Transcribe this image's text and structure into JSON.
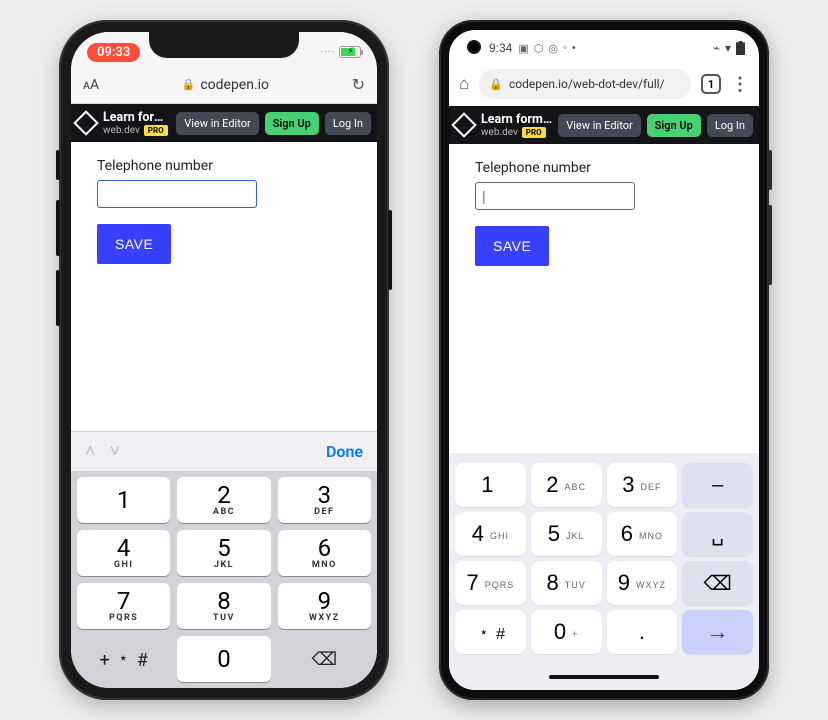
{
  "ios": {
    "status": {
      "time": "09:33"
    },
    "safari": {
      "url": "codepen.io"
    },
    "codepen": {
      "title": "Learn forms – virt…",
      "subtitle": "web.dev",
      "pro": "PRO",
      "view_btn": "View in Editor",
      "signup_btn": "Sign Up",
      "login_btn": "Log In"
    },
    "form": {
      "label": "Telephone number",
      "value": "",
      "save": "SAVE"
    },
    "accessory": {
      "done": "Done"
    },
    "keypad": {
      "symbols": "+ ﹡ #",
      "rows": [
        [
          {
            "n": "1",
            "l": ""
          },
          {
            "n": "2",
            "l": "ABC"
          },
          {
            "n": "3",
            "l": "DEF"
          }
        ],
        [
          {
            "n": "4",
            "l": "GHI"
          },
          {
            "n": "5",
            "l": "JKL"
          },
          {
            "n": "6",
            "l": "MNO"
          }
        ],
        [
          {
            "n": "7",
            "l": "PQRS"
          },
          {
            "n": "8",
            "l": "TUV"
          },
          {
            "n": "9",
            "l": "WXYZ"
          }
        ]
      ],
      "zero": "0"
    }
  },
  "android": {
    "status": {
      "time": "9:34"
    },
    "chrome": {
      "url": "codepen.io/web-dot-dev/full/",
      "tabs": "1"
    },
    "codepen": {
      "title": "Learn forms – virt…",
      "subtitle": "web.dev",
      "pro": "PRO",
      "view_btn": "View in Editor",
      "signup_btn": "Sign Up",
      "login_btn": "Log In"
    },
    "form": {
      "label": "Telephone number",
      "value": "",
      "save": "SAVE"
    },
    "keypad": {
      "rows": [
        [
          {
            "n": "1",
            "l": ""
          },
          {
            "n": "2",
            "l": "ABC"
          },
          {
            "n": "3",
            "l": "DEF"
          },
          {
            "func": "dash",
            "g": "–"
          }
        ],
        [
          {
            "n": "4",
            "l": "GHI"
          },
          {
            "n": "5",
            "l": "JKL"
          },
          {
            "n": "6",
            "l": "MNO"
          },
          {
            "func": "space",
            "g": "␣"
          }
        ],
        [
          {
            "n": "7",
            "l": "PQRS"
          },
          {
            "n": "8",
            "l": "TUV"
          },
          {
            "n": "9",
            "l": "WXYZ"
          },
          {
            "func": "backspace",
            "g": "⌫"
          }
        ],
        [
          {
            "n": "﹡ #",
            "l": ""
          },
          {
            "n": "0",
            "l": "+"
          },
          {
            "n": ".",
            "l": ""
          },
          {
            "func": "enter",
            "g": "→"
          }
        ]
      ]
    }
  }
}
